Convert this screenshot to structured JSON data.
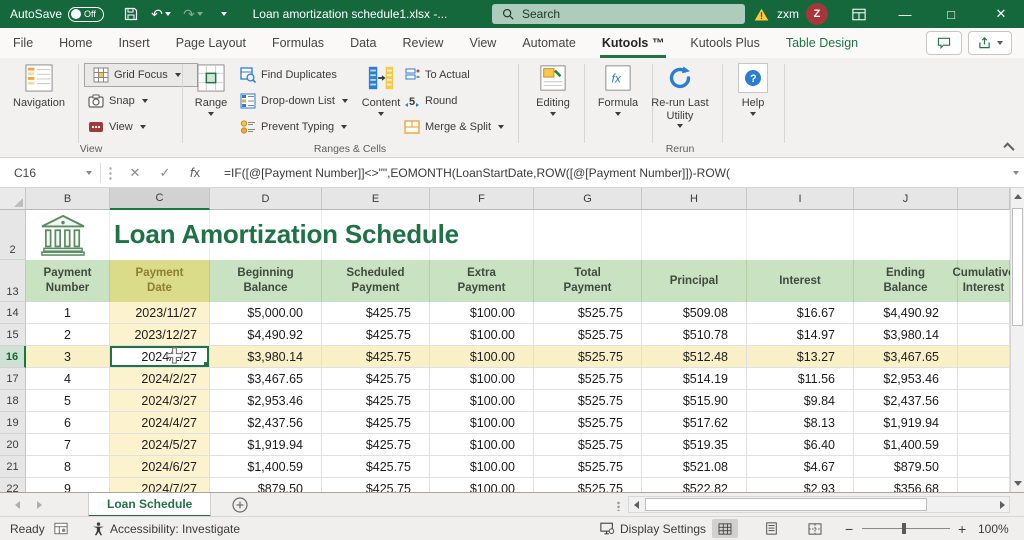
{
  "titlebar": {
    "autosave_label": "AutoSave",
    "autosave_state": "Off",
    "title": "Loan amortization schedule1.xlsx  -...",
    "search_placeholder": "Search",
    "user_short": "zxm",
    "avatar_initial": "Z",
    "minimize": "—",
    "maximize": "□",
    "close": "✕"
  },
  "tabs": [
    {
      "label": "File"
    },
    {
      "label": "Home"
    },
    {
      "label": "Insert"
    },
    {
      "label": "Page Layout"
    },
    {
      "label": "Formulas"
    },
    {
      "label": "Data"
    },
    {
      "label": "Review"
    },
    {
      "label": "View"
    },
    {
      "label": "Automate"
    },
    {
      "label": "Kutools ™",
      "active": true
    },
    {
      "label": "Kutools Plus"
    },
    {
      "label": "Table Design",
      "accent": true
    }
  ],
  "ribbon": {
    "navigation": "Navigation",
    "grid_focus": "Grid Focus",
    "snap": "Snap",
    "view_btn": "View",
    "view_group": "View",
    "range": "Range",
    "find_duplicates": "Find Duplicates",
    "dropdown_list": "Drop-down List",
    "prevent_typing": "Prevent Typing",
    "content": "Content",
    "to_actual": "To Actual",
    "round": "Round",
    "merge_split": "Merge & Split",
    "ranges_group": "Ranges & Cells",
    "editing": "Editing",
    "formula": "Formula",
    "rerun_btn": "Re-run Last Utility",
    "rerun_group": "Rerun",
    "help": "Help"
  },
  "formula_bar": {
    "name_box": "C16",
    "formula": "=IF([@[Payment Number]]<>\"\",EOMONTH(LoanStartDate,ROW([@[Payment Number]])-ROW("
  },
  "sheet": {
    "title": "Loan Amortization Schedule",
    "col_letters": [
      "B",
      "C",
      "D",
      "E",
      "F",
      "G",
      "H",
      "I",
      "J",
      ""
    ],
    "selected_col": "C",
    "row2_num": "2",
    "row13_num": "13",
    "table_headers": [
      "Payment\nNumber",
      "Payment\nDate",
      "Beginning\nBalance",
      "Scheduled\nPayment",
      "Extra\nPayment",
      "Total\nPayment",
      "Principal",
      "Interest",
      "Ending\nBalance",
      "Cumulative\nInterest"
    ],
    "rows": [
      {
        "num": "14",
        "cells": [
          "1",
          "2023/11/27",
          "$5,000.00",
          "$425.75",
          "$100.00",
          "$525.75",
          "$509.08",
          "$16.67",
          "$4,490.92",
          ""
        ]
      },
      {
        "num": "15",
        "cells": [
          "2",
          "2023/12/27",
          "$4,490.92",
          "$425.75",
          "$100.00",
          "$525.75",
          "$510.78",
          "$14.97",
          "$3,980.14",
          ""
        ]
      },
      {
        "num": "16",
        "selected": true,
        "cells": [
          "3",
          "2024/1/27",
          "$3,980.14",
          "$425.75",
          "$100.00",
          "$525.75",
          "$512.48",
          "$13.27",
          "$3,467.65",
          ""
        ]
      },
      {
        "num": "17",
        "cells": [
          "4",
          "2024/2/27",
          "$3,467.65",
          "$425.75",
          "$100.00",
          "$525.75",
          "$514.19",
          "$11.56",
          "$2,953.46",
          ""
        ]
      },
      {
        "num": "18",
        "cells": [
          "5",
          "2024/3/27",
          "$2,953.46",
          "$425.75",
          "$100.00",
          "$525.75",
          "$515.90",
          "$9.84",
          "$2,437.56",
          ""
        ]
      },
      {
        "num": "19",
        "cells": [
          "6",
          "2024/4/27",
          "$2,437.56",
          "$425.75",
          "$100.00",
          "$525.75",
          "$517.62",
          "$8.13",
          "$1,919.94",
          ""
        ]
      },
      {
        "num": "20",
        "cells": [
          "7",
          "2024/5/27",
          "$1,919.94",
          "$425.75",
          "$100.00",
          "$525.75",
          "$519.35",
          "$6.40",
          "$1,400.59",
          ""
        ]
      },
      {
        "num": "21",
        "cells": [
          "8",
          "2024/6/27",
          "$1,400.59",
          "$425.75",
          "$100.00",
          "$525.75",
          "$521.08",
          "$4.67",
          "$879.50",
          ""
        ]
      },
      {
        "num": "22",
        "partial": true,
        "cells": [
          "9",
          "2024/7/27",
          "$879.50",
          "$425.75",
          "$100.00",
          "$525.75",
          "$522.82",
          "$2.93",
          "$356.68",
          ""
        ]
      }
    ]
  },
  "sheet_tabs": {
    "active": "Loan Schedule"
  },
  "statusbar": {
    "ready": "Ready",
    "accessibility": "Accessibility: Investigate",
    "display_settings": "Display Settings",
    "zoom_level": "100%"
  },
  "colors": {
    "accent_green": "#217346",
    "titlebar_green": "#15683C",
    "highlight_yellow": "#FCF2CD",
    "header_green": "#C9E2C2"
  }
}
